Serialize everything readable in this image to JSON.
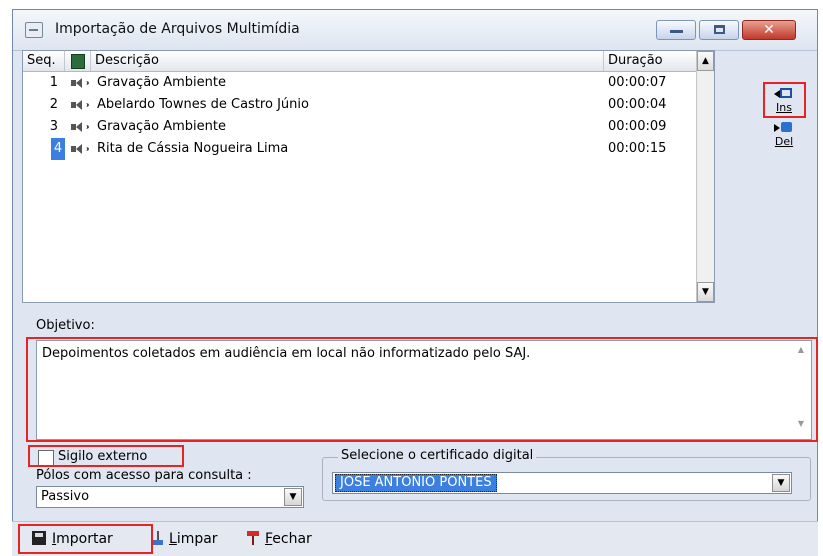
{
  "window": {
    "title": "Importação de Arquivos Multimídia",
    "close_glyph": "✕"
  },
  "list": {
    "headers": {
      "seq": "Seq.",
      "descricao": "Descrição",
      "duracao": "Duração"
    },
    "rows": [
      {
        "seq": "1",
        "descricao": "Gravação Ambiente",
        "duracao": "00:00:07",
        "selected": false
      },
      {
        "seq": "2",
        "descricao": "Abelardo Townes de Castro Júnio",
        "duracao": "00:00:04",
        "selected": false
      },
      {
        "seq": "3",
        "descricao": "Gravação Ambiente",
        "duracao": "00:00:09",
        "selected": false
      },
      {
        "seq": "4",
        "descricao": "Rita de Cássia Nogueira Lima",
        "duracao": "00:00:15",
        "selected": true
      }
    ]
  },
  "side_buttons": {
    "ins_label": "Ins",
    "del_label": "Del"
  },
  "objetivo": {
    "label": "Objetivo:",
    "text": "Depoimentos coletados em audiência em local não informatizado pelo SAJ."
  },
  "sigilo": {
    "label": "Sigilo externo",
    "checked": false
  },
  "polos": {
    "label": "Pólos com acesso para consulta :",
    "value": "Passivo"
  },
  "certificado": {
    "legend": "Selecione o certificado digital",
    "value": "JOSE ANTONIO PONTES"
  },
  "toolbar": {
    "importar_u": "I",
    "importar_rest": "mportar",
    "limpar_u": "L",
    "limpar_rest": "impar",
    "fechar_u": "F",
    "fechar_rest": "echar"
  },
  "colors": {
    "selection": "#3b7fe0",
    "highlight": "#e62424",
    "window_bg": "#dfe6f1"
  }
}
